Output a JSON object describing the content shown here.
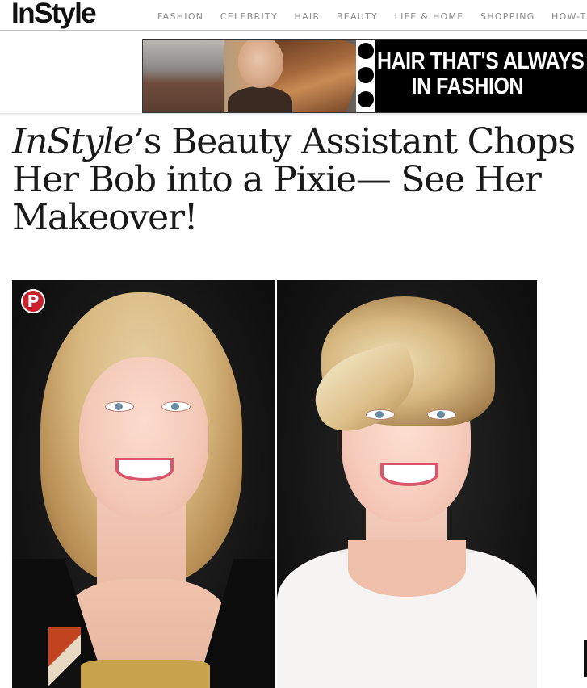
{
  "header": {
    "logo": "InStyle",
    "nav": [
      "FASHION",
      "CELEBRITY",
      "HAIR",
      "BEAUTY",
      "LIFE & HOME",
      "SHOPPING",
      "HOW-TO"
    ]
  },
  "ad": {
    "line1": "HAIR THAT'S ALWAYS",
    "line2": "IN FASHION"
  },
  "article": {
    "title_italic": "InStyle",
    "title_rest": "’s Beauty Assistant Chops Her Bob into a Pixie— See Her Makeover!"
  },
  "pinterest": {
    "glyph": "P"
  },
  "colors": {
    "pinterest_red": "#c8232c",
    "text": "#1a1a1a",
    "nav_gray": "#8a8a8a"
  }
}
